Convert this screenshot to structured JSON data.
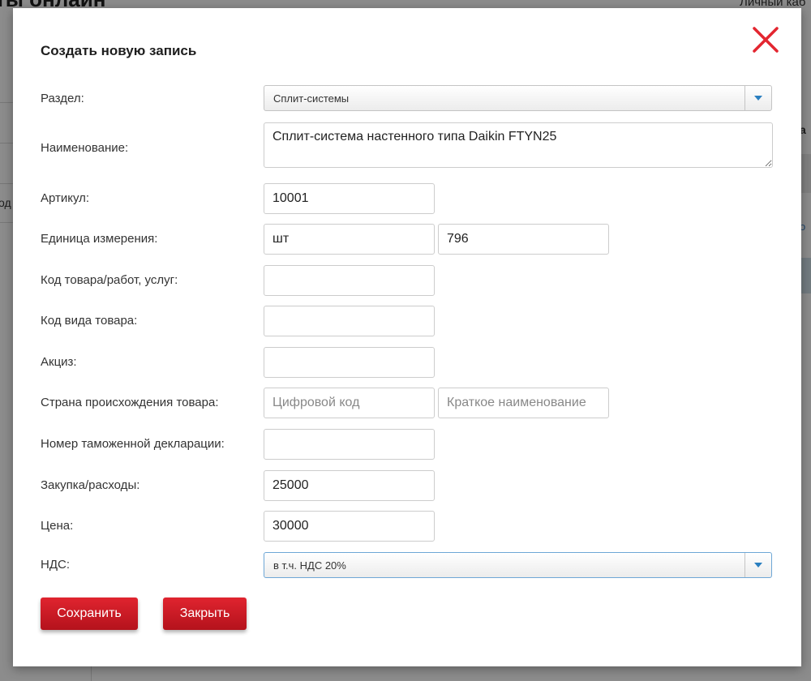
{
  "background": {
    "title": "ты онлайн",
    "personal_cabinet": "Личный каб",
    "side_text": "од",
    "right_text": "а",
    "right_link": "о"
  },
  "modal": {
    "title": "Создать новую запись",
    "close_icon": "close-x-icon",
    "accent_color": "#e32630"
  },
  "form": {
    "section": {
      "label": "Раздел:",
      "value": "Сплит-системы"
    },
    "name": {
      "label": "Наименование:",
      "value": "Сплит-система настенного типа Daikin FTYN25"
    },
    "article": {
      "label": "Артикул:",
      "value": "10001"
    },
    "unit": {
      "label": "Единица измерения:",
      "name_value": "шт",
      "code_value": "796"
    },
    "product_code": {
      "label": "Код товара/работ, услуг:",
      "value": ""
    },
    "product_type_code": {
      "label": "Код вида товара:",
      "value": ""
    },
    "excise": {
      "label": "Акциз:",
      "value": ""
    },
    "origin_country": {
      "label": "Страна происхождения товара:",
      "code_placeholder": "Цифровой код",
      "name_placeholder": "Краткое наименование"
    },
    "customs_declaration": {
      "label": "Номер таможенной декларации:",
      "value": ""
    },
    "purchase": {
      "label": "Закупка/расходы:",
      "value": "25000"
    },
    "price": {
      "label": "Цена:",
      "value": "30000"
    },
    "vat": {
      "label": "НДС:",
      "value": "в т.ч. НДС 20%"
    }
  },
  "buttons": {
    "save": "Сохранить",
    "close": "Закрыть"
  }
}
